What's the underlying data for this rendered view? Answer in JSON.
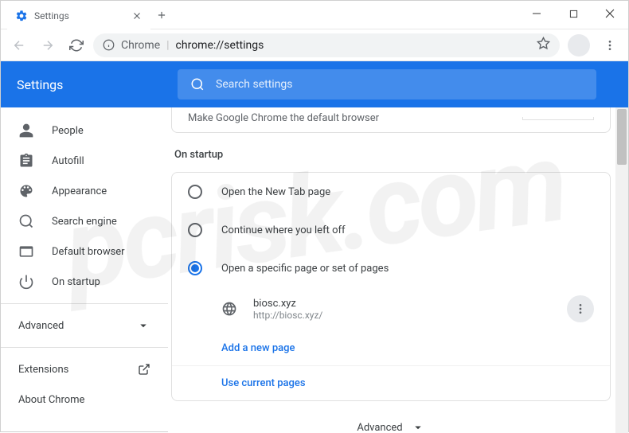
{
  "window": {
    "tab_title": "Settings"
  },
  "toolbar": {
    "chrome_label": "Chrome",
    "url": "chrome://settings"
  },
  "header": {
    "title": "Settings",
    "search_placeholder": "Search settings"
  },
  "sidebar": {
    "people": "People",
    "autofill": "Autofill",
    "appearance": "Appearance",
    "search_engine": "Search engine",
    "default_browser": "Default browser",
    "on_startup": "On startup",
    "advanced": "Advanced",
    "extensions": "Extensions",
    "about": "About Chrome"
  },
  "content": {
    "default_browser_hint": "Make Google Chrome the default browser",
    "section_title": "On startup",
    "radio_newtab": "Open the New Tab page",
    "radio_continue": "Continue where you left off",
    "radio_specific": "Open a specific page or set of pages",
    "startup_page": {
      "name": "biosc.xyz",
      "url": "http://biosc.xyz/"
    },
    "add_page": "Add a new page",
    "use_current": "Use current pages",
    "advanced_footer": "Advanced"
  }
}
